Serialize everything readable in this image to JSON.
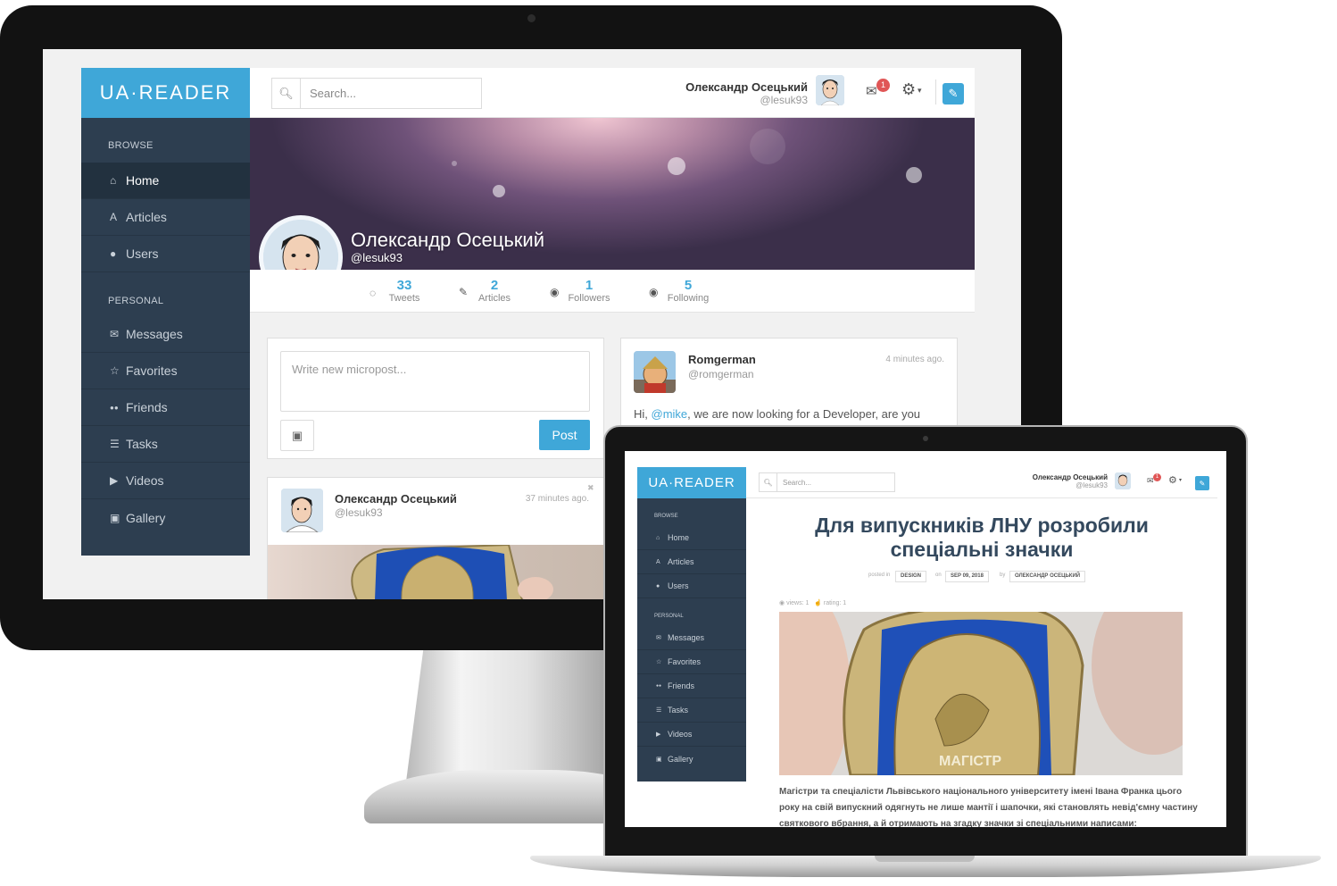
{
  "brand": {
    "logo": "UA·READER",
    "accent": "#3fa7d8",
    "sidebar_bg": "#2d3e50"
  },
  "header": {
    "search_placeholder": "Search...",
    "user_name": "Олександр Осецький",
    "user_handle": "@lesuk93",
    "messages_badge": "1",
    "icons": {
      "search": "search-icon",
      "mail": "envelope-icon",
      "settings": "gear-icon",
      "compose": "pencil-icon"
    }
  },
  "sidebar": {
    "browse_heading": "BROWSE",
    "personal_heading": "PERSONAL",
    "items": [
      {
        "label": "Home",
        "icon": "home-icon",
        "glyph": "⌂"
      },
      {
        "label": "Articles",
        "icon": "font-icon",
        "glyph": "A"
      },
      {
        "label": "Users",
        "icon": "user-icon",
        "glyph": "●"
      },
      {
        "label": "Messages",
        "icon": "envelope-icon",
        "glyph": "✉"
      },
      {
        "label": "Favorites",
        "icon": "star-icon",
        "glyph": "☆"
      },
      {
        "label": "Friends",
        "icon": "users-icon",
        "glyph": "●●"
      },
      {
        "label": "Tasks",
        "icon": "list-icon",
        "glyph": "☰"
      },
      {
        "label": "Videos",
        "icon": "video-icon",
        "glyph": "▶"
      },
      {
        "label": "Gallery",
        "icon": "image-icon",
        "glyph": "▣"
      }
    ]
  },
  "profile": {
    "name": "Олександр Осецький",
    "handle": "@lesuk93",
    "stats": [
      {
        "value": "33",
        "label": "Tweets",
        "icon": "comment-icon",
        "glyph": "◌"
      },
      {
        "value": "2",
        "label": "Articles",
        "icon": "pencil-icon",
        "glyph": "✎"
      },
      {
        "value": "1",
        "label": "Followers",
        "icon": "eye-icon",
        "glyph": "◉"
      },
      {
        "value": "5",
        "label": "Following",
        "icon": "eye-icon",
        "glyph": "◉"
      }
    ]
  },
  "composer": {
    "placeholder": "Write new micropost...",
    "post_label": "Post",
    "image_icon": "image-icon"
  },
  "feed": [
    {
      "name": "Romgerman",
      "handle": "@romgerman",
      "time": "4 minutes ago.",
      "text_before": "Hi, ",
      "mention": "@mike",
      "text_after": ", we are now looking for a Developer, are you"
    },
    {
      "name": "Олександр Осецький",
      "handle": "@lesuk93",
      "time": "37 minutes ago.",
      "close": "✖"
    }
  ],
  "article": {
    "title": "Для випускників ЛНУ розробили спеціальні значки",
    "posted_in_label": "posted in",
    "category": "DESIGN",
    "on_label": "on",
    "date": "SEP 09, 2018",
    "by_label": "by",
    "author": "ОЛЕКСАНДР ОСЕЦЬКИЙ",
    "views": "views: 1",
    "rating": "rating: 1",
    "badge_text": "МАГІСТР",
    "body": "Магістри та спеціалісти Львівського національного університету імені Івана Франка цього року на свій випускний одягнуть не лише мантії і шапочки, які становлять невід'ємну частину святкового вбрання, а й отримають на згадку значки зі спеціальними написами:"
  }
}
